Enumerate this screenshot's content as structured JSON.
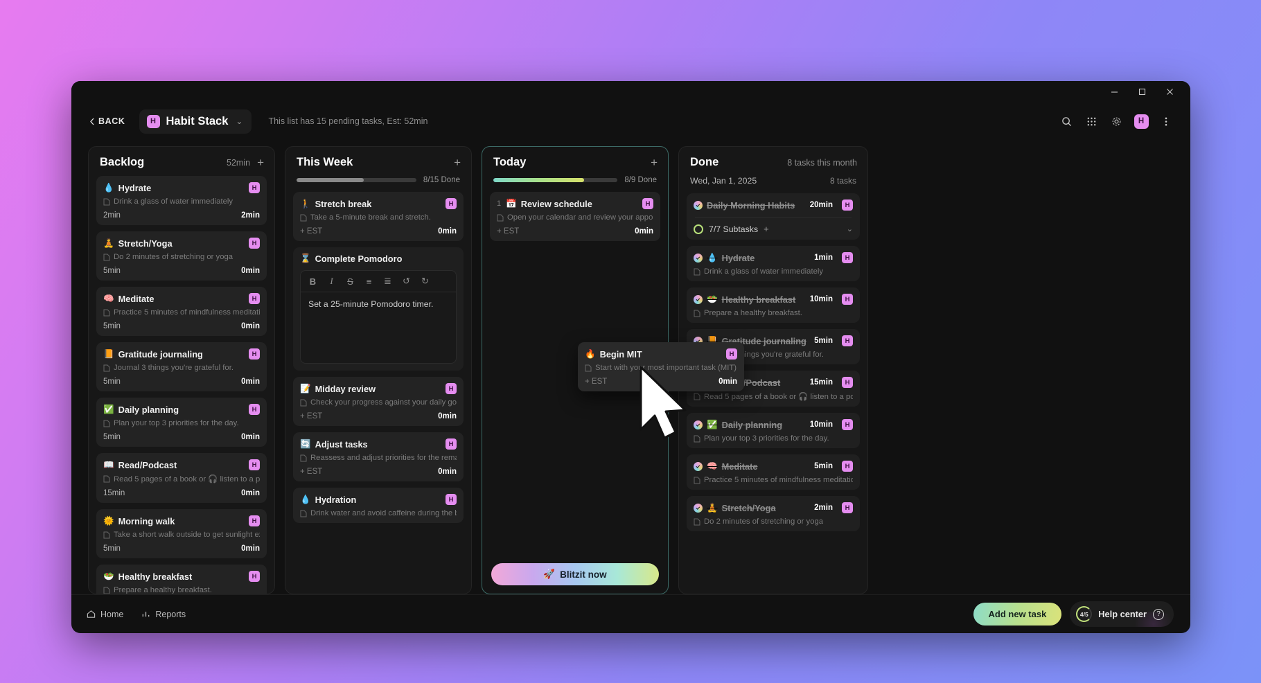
{
  "window": {
    "controls": [
      "minimize",
      "maximize",
      "close"
    ]
  },
  "header": {
    "back_label": "BACK",
    "list_badge": "H",
    "list_title": "Habit Stack",
    "chevron": "⌄",
    "subtitle": "This list has 15 pending tasks, Est: 52min",
    "icons": [
      "search-icon",
      "grid-icon",
      "gear-icon",
      "avatar",
      "more-icon"
    ],
    "avatar_initial": "H",
    "accent": "#e58df0"
  },
  "columns": [
    {
      "key": "backlog",
      "title": "Backlog",
      "meta": "52min",
      "add_label": "+",
      "tasks": [
        {
          "emoji": "💧",
          "title": "Hydrate",
          "desc": "Drink a glass of water immediately",
          "est": "2min",
          "spent": "2min",
          "badge": "H"
        },
        {
          "emoji": "🧘",
          "title": "Stretch/Yoga",
          "desc": "Do 2 minutes of stretching or yoga",
          "est": "5min",
          "spent": "0min",
          "badge": "H"
        },
        {
          "emoji": "🧠",
          "title": "Meditate",
          "desc": "Practice 5 minutes of mindfulness meditation...",
          "est": "5min",
          "spent": "0min",
          "badge": "H"
        },
        {
          "emoji": "📙",
          "title": "Gratitude journaling",
          "desc": "Journal 3 things you're grateful for.",
          "est": "5min",
          "spent": "0min",
          "badge": "H"
        },
        {
          "emoji": "✅",
          "title": "Daily planning",
          "desc": "Plan your top 3 priorities for the day.",
          "est": "5min",
          "spent": "0min",
          "badge": "H"
        },
        {
          "emoji": "📖",
          "title": "Read/Podcast",
          "desc": "Read 5 pages of a book or 🎧 listen to a pod...",
          "est": "15min",
          "spent": "0min",
          "badge": "H"
        },
        {
          "emoji": "🌞",
          "title": "Morning walk",
          "desc": "Take a short walk outside to get sunlight ex...",
          "est": "5min",
          "spent": "0min",
          "badge": "H"
        },
        {
          "emoji": "🥗",
          "title": "Healthy breakfast",
          "desc": "Prepare a healthy breakfast.",
          "est": "",
          "spent": "",
          "badge": "H"
        }
      ]
    },
    {
      "key": "this_week",
      "title": "This Week",
      "progress_label": "8/15 Done",
      "progress_pct": 56,
      "add_label": "+",
      "tasks": [
        {
          "emoji": "🚶",
          "title": "Stretch break",
          "desc": "Take a 5-minute break and stretch.",
          "est": "+ EST",
          "spent": "0min",
          "badge": "H"
        },
        {
          "emoji": "⌛",
          "title": "Complete Pomodoro",
          "desc": "",
          "est": "",
          "spent": "",
          "badge": "",
          "editor": true,
          "toolbar": [
            "B",
            "I",
            "S",
            "bullet-list",
            "numbered-list",
            "undo",
            "redo"
          ],
          "editor_text": "Set a 25-minute Pomodoro timer."
        },
        {
          "emoji": "📝",
          "title": "Midday review",
          "desc": "Check your progress against your daily goals.",
          "est": "+ EST",
          "spent": "0min",
          "badge": "H"
        },
        {
          "emoji": "🔄",
          "title": "Adjust tasks",
          "desc": "Reassess and adjust priorities for the remai...",
          "est": "+ EST",
          "spent": "0min",
          "badge": "H"
        },
        {
          "emoji": "💧",
          "title": "Hydration",
          "desc": "Drink water and avoid caffeine during the br...",
          "est": "",
          "spent": "",
          "badge": "H"
        }
      ]
    },
    {
      "key": "today",
      "title": "Today",
      "progress_label": "8/9 Done",
      "progress_pct": 73,
      "add_label": "+",
      "blitz_label": "Blitzit now",
      "blitz_icon": "🚀",
      "tasks": [
        {
          "index": "1",
          "emoji": "📅",
          "title": "Review schedule",
          "desc": "Open your calendar and review your appointm...",
          "est": "+ EST",
          "spent": "0min",
          "badge": "H"
        }
      ]
    },
    {
      "key": "done",
      "title": "Done",
      "meta": "8 tasks this month",
      "date": "Wed, Jan 1, 2025",
      "count": "8 tasks",
      "tasks": [
        {
          "emoji": "",
          "title": "Daily Morning Habits",
          "desc": "",
          "est": "20min",
          "badge": "H",
          "subtasks_label": "7/7 Subtasks",
          "subtasks_plus": "+",
          "subtasks_chevron": "⌄"
        },
        {
          "emoji": "💧",
          "title": "Hydrate",
          "desc": "Drink a glass of water immediately",
          "est": "1min",
          "badge": "H"
        },
        {
          "emoji": "🥗",
          "title": "Healthy breakfast",
          "desc": "Prepare a healthy breakfast.",
          "est": "10min",
          "badge": "H"
        },
        {
          "emoji": "📙",
          "title": "Gratitude journaling",
          "desc": "Journal 3 things you're grateful for.",
          "est": "5min",
          "badge": "H"
        },
        {
          "emoji": "📖",
          "title": "Read/Podcast",
          "desc": "Read 5 pages of a book or 🎧 listen to a pod...",
          "est": "15min",
          "badge": "H"
        },
        {
          "emoji": "✅",
          "title": "Daily planning",
          "desc": "Plan your top 3 priorities for the day.",
          "est": "10min",
          "badge": "H"
        },
        {
          "emoji": "🧠",
          "title": "Meditate",
          "desc": "Practice 5 minutes of mindfulness meditation...",
          "est": "5min",
          "badge": "H"
        },
        {
          "emoji": "🧘",
          "title": "Stretch/Yoga",
          "desc": "Do 2 minutes of stretching or yoga",
          "est": "2min",
          "badge": "H"
        }
      ]
    }
  ],
  "drag_card": {
    "emoji": "🔥",
    "title": "Begin MIT",
    "desc": "Start with your most important task (MIT)",
    "est": "+ EST",
    "spent": "0min",
    "badge": "H"
  },
  "footer": {
    "home_label": "Home",
    "reports_label": "Reports",
    "add_task_label": "Add new task",
    "help_count": "4/5",
    "help_label": "Help center",
    "help_mark": "?"
  }
}
